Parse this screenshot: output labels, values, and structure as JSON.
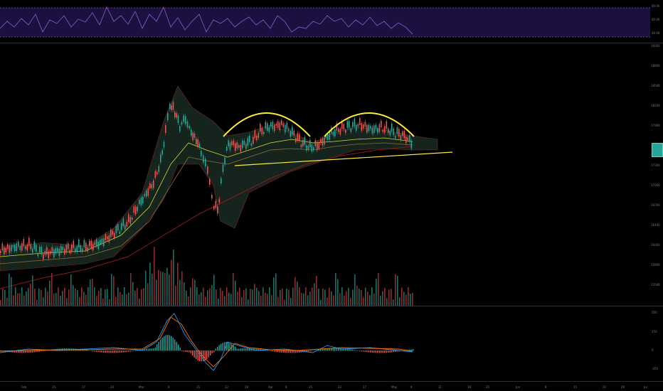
{
  "colors": {
    "background": "#000000",
    "candle_up": "#26a69a",
    "candle_down": "#ef5350",
    "rsi": "#7e57c2",
    "pattern": "#ffeb3b",
    "bollinger_fill": "#1b2b22",
    "ma_slow": "#b71c1c",
    "ma_fast": "#cddc39"
  },
  "rsi_axis": {
    "ticks": [
      "80.00",
      "60.00",
      "40.00"
    ]
  },
  "price_axis": {
    "ticks": [
      "19100",
      "18800",
      "18500",
      "18200",
      "17900",
      "17600",
      "17300",
      "17000",
      "16700",
      "16400",
      "16100",
      "15800",
      "15500"
    ]
  },
  "macd_axis": {
    "ticks": [
      "500",
      "250",
      "0",
      "-250"
    ]
  },
  "date_axis": {
    "labels": [
      "Feb",
      "15",
      "17",
      "24",
      "Mar",
      "8",
      "15",
      "22",
      "29",
      "Apr",
      "8",
      "15",
      "22",
      "27",
      "May",
      "4",
      "11",
      "18",
      "25",
      "Jun",
      "8",
      "15",
      "22",
      "29",
      "Jul"
    ]
  },
  "annotations": {
    "pattern": "double-top arcs with neckline",
    "icons": [
      "arc-left",
      "arc-right",
      "neckline"
    ]
  }
}
